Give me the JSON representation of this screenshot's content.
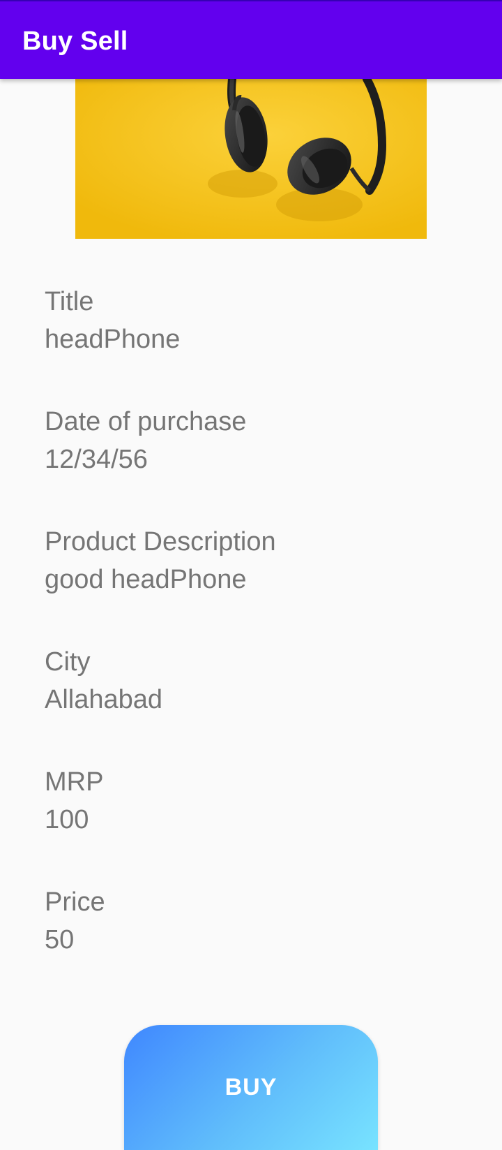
{
  "app_bar": {
    "title": "Buy Sell"
  },
  "product_image": {
    "description_icon": "headphones-photo",
    "background_color": "#f5bf0f"
  },
  "details": {
    "title_label": "Title",
    "title_value": "headPhone",
    "date_label": "Date of purchase",
    "date_value": "12/34/56",
    "description_label": "Product Description",
    "description_value": "good headPhone",
    "city_label": "City",
    "city_value": "Allahabad",
    "mrp_label": "MRP",
    "mrp_value": "100",
    "price_label": "Price",
    "price_value": "50"
  },
  "actions": {
    "buy_label": "BUY"
  },
  "colors": {
    "app_bar": "#6200ee",
    "text": "#757575",
    "button_gradient_start": "#3f87ff",
    "button_gradient_end": "#78e3ff"
  }
}
